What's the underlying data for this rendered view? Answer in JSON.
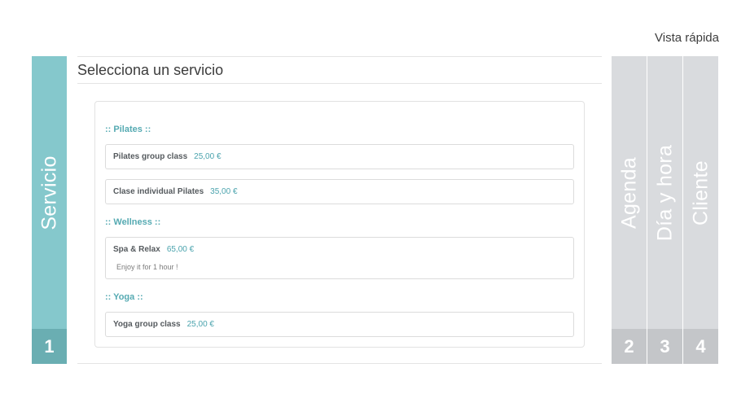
{
  "header": {
    "quick_view_label": "Vista rápida"
  },
  "steps": [
    {
      "label": "Servicio",
      "number": "1",
      "active": true
    },
    {
      "label": "Agenda",
      "number": "2",
      "active": false
    },
    {
      "label": "Día y hora",
      "number": "3",
      "active": false
    },
    {
      "label": "Cliente",
      "number": "4",
      "active": false
    }
  ],
  "main": {
    "title": "Selecciona un servicio",
    "categories": [
      {
        "name": ":: Pilates ::",
        "services": [
          {
            "name": "Pilates group class",
            "price": "25,00 €"
          },
          {
            "name": "Clase individual Pilates",
            "price": "35,00 €"
          }
        ]
      },
      {
        "name": ":: Wellness ::",
        "services": [
          {
            "name": "Spa & Relax",
            "price": "65,00 €",
            "description": "Enjoy it for 1 hour !"
          }
        ]
      },
      {
        "name": ":: Yoga ::",
        "services": [
          {
            "name": "Yoga group class",
            "price": "25,00 €"
          }
        ]
      }
    ]
  },
  "colors": {
    "active_step": "#85c8cc",
    "active_step_number": "#6aaeb2",
    "inactive_step": "#d9dbde",
    "inactive_step_number": "#c4c6c9",
    "accent": "#55aab2"
  }
}
